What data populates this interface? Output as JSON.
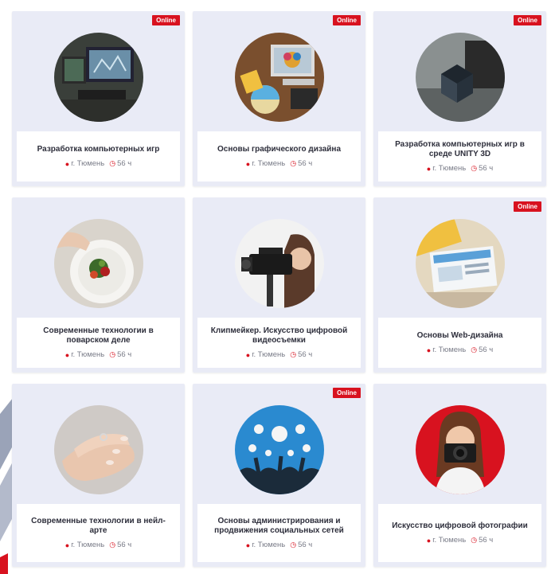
{
  "badge_label": "Online",
  "accent_color": "#d8121f",
  "courses": [
    {
      "title": "Разработка компьютерных игр",
      "city": "г. Тюмень",
      "duration": "56 ч",
      "online": true,
      "image": "game-dev-photo"
    },
    {
      "title": "Основы графического дизайна",
      "city": "г. Тюмень",
      "duration": "56 ч",
      "online": true,
      "image": "graphic-design-photo"
    },
    {
      "title": "Разработка компьютерных игр в среде UNITY 3D",
      "city": "г. Тюмень",
      "duration": "56 ч",
      "online": true,
      "image": "unity-photo"
    },
    {
      "title": "Современные технологии в поварском деле",
      "city": "г. Тюмень",
      "duration": "56 ч",
      "online": false,
      "image": "cooking-photo"
    },
    {
      "title": "Клипмейкер. Искусство цифровой видеосъемки",
      "city": "г. Тюмень",
      "duration": "56 ч",
      "online": false,
      "image": "video-camera-photo"
    },
    {
      "title": "Основы Web-дизайна",
      "city": "г. Тюмень",
      "duration": "56 ч",
      "online": true,
      "image": "web-design-photo"
    },
    {
      "title": "Современные технологии в нейл-арте",
      "city": "г. Тюмень",
      "duration": "56 ч",
      "online": false,
      "image": "nail-art-photo"
    },
    {
      "title": "Основы администрирования и продвижения социальных сетей",
      "city": "г. Тюмень",
      "duration": "56 ч",
      "online": true,
      "image": "social-media-photo"
    },
    {
      "title": "Искусство цифровой фотографии",
      "city": "г. Тюмень",
      "duration": "56 ч",
      "online": false,
      "image": "photography-photo"
    }
  ]
}
